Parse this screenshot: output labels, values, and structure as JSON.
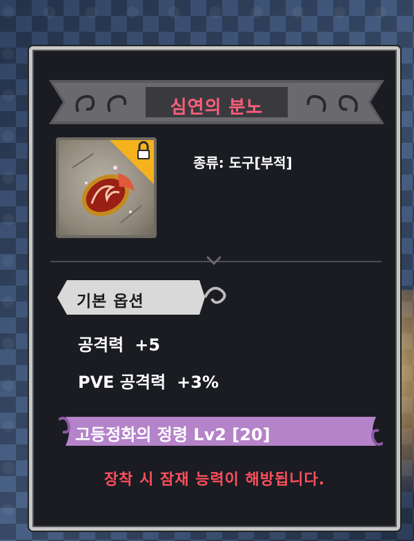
{
  "item": {
    "name": "심연의 분노",
    "type_label": "종류: 도구[부적]",
    "locked": true
  },
  "basic_options": {
    "section_label": "기본 옵션",
    "stats": [
      {
        "name": "공격력",
        "value": "+5"
      },
      {
        "name": "PVE 공격력",
        "value": "+3%"
      }
    ]
  },
  "spirit": {
    "label": "고등정화의 정령 Lv2 [20]"
  },
  "notice": "장착 시 잠재 능력이 해방됩니다.",
  "colors": {
    "title": "#ff5f7a",
    "notice": "#ff4f5d",
    "panel_bg": "#1a1c22",
    "spirit_banner": "#b583c9",
    "lock_badge": "#f5b21d"
  },
  "icons": [
    "lock-icon",
    "talisman-icon"
  ]
}
